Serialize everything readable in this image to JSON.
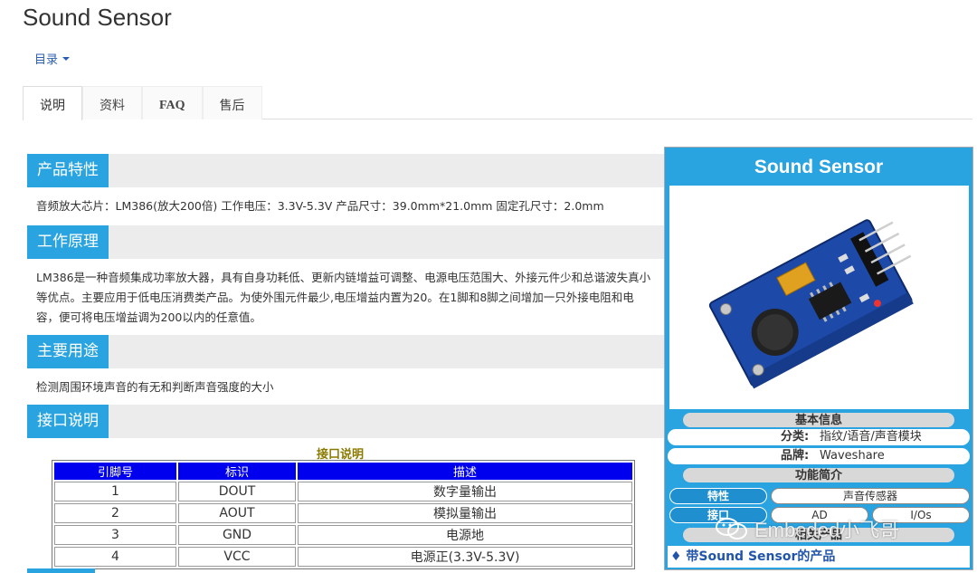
{
  "page": {
    "title": "Sound Sensor"
  },
  "toc": {
    "label": "目录"
  },
  "tabs": [
    {
      "label": "说明",
      "active": true
    },
    {
      "label": "资料",
      "active": false
    },
    {
      "label": "FAQ",
      "active": false
    },
    {
      "label": "售后",
      "active": false
    }
  ],
  "sections": {
    "features": {
      "heading": "产品特性",
      "text": "音频放大芯片：LM386(放大200倍) 工作电压：3.3V-5.3V 产品尺寸：39.0mm*21.0mm 固定孔尺寸：2.0mm"
    },
    "principle": {
      "heading": "工作原理",
      "text": "LM386是一种音频集成功率放大器，具有自身功耗低、更新内链增益可调整、电源电压范围大、外接元件少和总谐波失真小等优点。主要应用于低电压消费类产品。为使外围元件最少,电压增益内置为20。在1脚和8脚之间增加一只外接电阻和电容，便可将电压增益调为200以内的任意值。"
    },
    "usage": {
      "heading": "主要用途",
      "text": "检测周围环境声音的有无和判断声音强度的大小"
    },
    "interface": {
      "heading": "接口说明"
    }
  },
  "iface_table": {
    "caption": "接口说明",
    "headers": [
      "引脚号",
      "标识",
      "描述"
    ],
    "rows": [
      [
        "1",
        "DOUT",
        "数字量输出"
      ],
      [
        "2",
        "AOUT",
        "模拟量输出"
      ],
      [
        "3",
        "GND",
        "电源地"
      ],
      [
        "4",
        "VCC",
        "电源正(3.3V-5.3V)"
      ]
    ]
  },
  "infobox": {
    "title": "Sound Sensor",
    "basic_header": "基本信息",
    "category_key": "分类:",
    "category_value": "指纹/语音/声音模块",
    "brand_key": "品牌:",
    "brand_value": "Waveshare",
    "func_header": "功能简介",
    "feature_key": "特性",
    "feature_value": "声音传感器",
    "interface_key": "接口",
    "interface_v1": "AD",
    "interface_v2": "I/Os",
    "related_header": "相关产品",
    "related_link": "♦ 带Sound Sensor的产品"
  },
  "watermark": {
    "text": "Embeded小飞哥"
  },
  "colors": {
    "accent": "#2aa4e0",
    "table_header": "#0000ee",
    "link": "#2a5db0"
  }
}
